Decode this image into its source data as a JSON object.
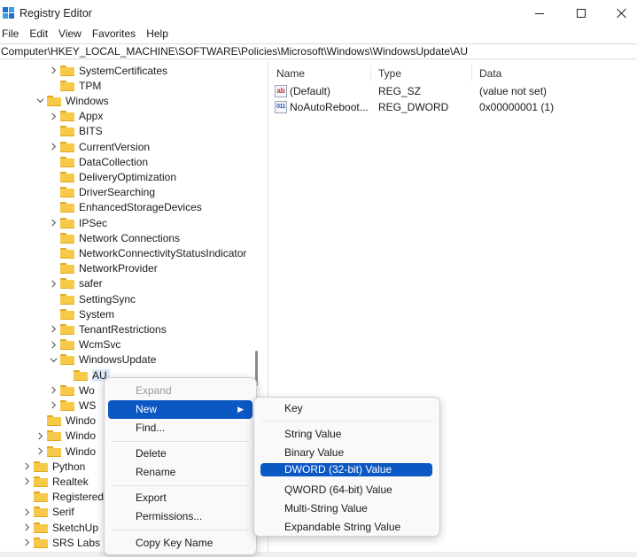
{
  "window": {
    "title": "Registry Editor"
  },
  "menubar": [
    "File",
    "Edit",
    "View",
    "Favorites",
    "Help"
  ],
  "address": "Computer\\HKEY_LOCAL_MACHINE\\SOFTWARE\\Policies\\Microsoft\\Windows\\WindowsUpdate\\AU",
  "tree": [
    {
      "label": "SystemCertificates",
      "chevron": "right"
    },
    {
      "label": "TPM",
      "chevron": "none"
    },
    {
      "label": "Windows",
      "chevron": "down"
    },
    {
      "label": "Appx",
      "chevron": "right"
    },
    {
      "label": "BITS",
      "chevron": "none"
    },
    {
      "label": "CurrentVersion",
      "chevron": "right"
    },
    {
      "label": "DataCollection",
      "chevron": "none"
    },
    {
      "label": "DeliveryOptimization",
      "chevron": "none"
    },
    {
      "label": "DriverSearching",
      "chevron": "none"
    },
    {
      "label": "EnhancedStorageDevices",
      "chevron": "none"
    },
    {
      "label": "IPSec",
      "chevron": "right"
    },
    {
      "label": "Network Connections",
      "chevron": "none"
    },
    {
      "label": "NetworkConnectivityStatusIndicator",
      "chevron": "none"
    },
    {
      "label": "NetworkProvider",
      "chevron": "none"
    },
    {
      "label": "safer",
      "chevron": "right"
    },
    {
      "label": "SettingSync",
      "chevron": "none"
    },
    {
      "label": "System",
      "chevron": "none"
    },
    {
      "label": "TenantRestrictions",
      "chevron": "right"
    },
    {
      "label": "WcmSvc",
      "chevron": "right"
    },
    {
      "label": "WindowsUpdate",
      "chevron": "down"
    },
    {
      "label": "AU",
      "chevron": "none",
      "selected": true
    },
    {
      "label": "Wo",
      "chevron": "right"
    },
    {
      "label": "WS",
      "chevron": "right"
    },
    {
      "label": "Windo",
      "chevron": "none"
    },
    {
      "label": "Windo",
      "chevron": "right"
    },
    {
      "label": "Windo",
      "chevron": "right"
    },
    {
      "label": "Python",
      "chevron": "right"
    },
    {
      "label": "Realtek",
      "chevron": "right"
    },
    {
      "label": "RegisteredAp",
      "chevron": "none"
    },
    {
      "label": "Serif",
      "chevron": "right"
    },
    {
      "label": "SketchUp",
      "chevron": "right"
    },
    {
      "label": "SRS Labs",
      "chevron": "right"
    }
  ],
  "values_pane": {
    "headers": {
      "name": "Name",
      "type": "Type",
      "data": "Data"
    },
    "rows": [
      {
        "icon": "ab",
        "name": "(Default)",
        "type": "REG_SZ",
        "data": "(value not set)"
      },
      {
        "icon": "011",
        "name": "NoAutoReboot...",
        "type": "REG_DWORD",
        "data": "0x00000001 (1)"
      }
    ]
  },
  "context_menu": {
    "expand": "Expand",
    "new": "New",
    "find": "Find...",
    "delete": "Delete",
    "rename": "Rename",
    "export": "Export",
    "permissions": "Permissions...",
    "copy_key_name": "Copy Key Name"
  },
  "new_submenu": {
    "key": "Key",
    "string_value": "String Value",
    "binary_value": "Binary Value",
    "dword_value": "DWORD (32-bit) Value",
    "qword_value": "QWORD (64-bit) Value",
    "multi_string_value": "Multi-String Value",
    "expandable_string_value": "Expandable String Value"
  },
  "colors": {
    "highlight": "#0b57c4",
    "folder": "#f7c948",
    "selection": "#d9e7f7"
  }
}
